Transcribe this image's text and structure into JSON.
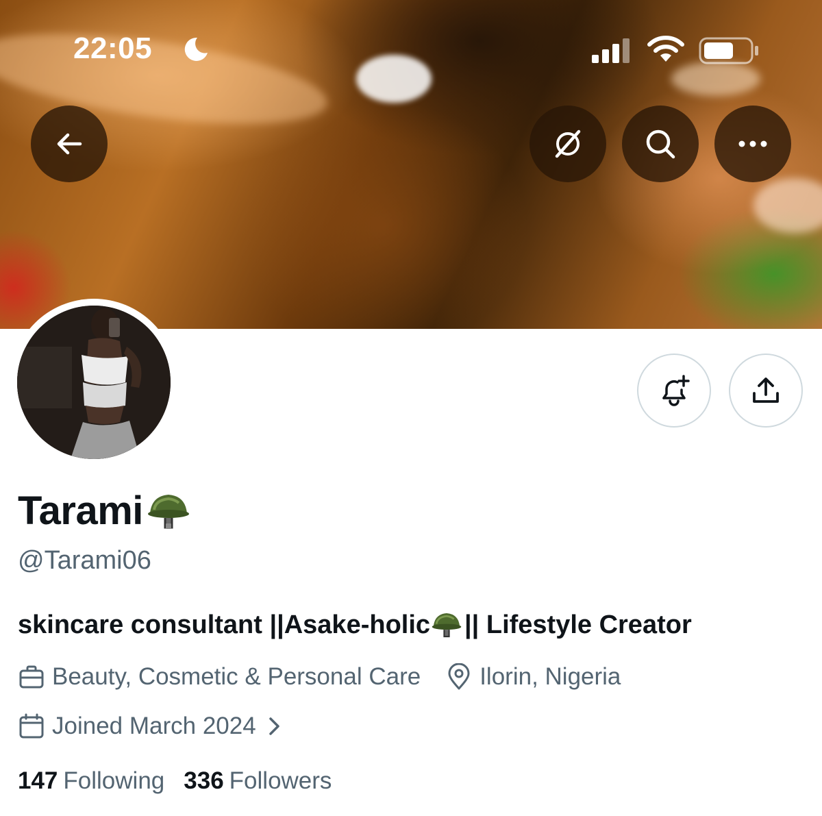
{
  "status_bar": {
    "time": "22:05"
  },
  "header": {
    "icons": [
      "back-arrow-icon",
      "grok-icon",
      "search-icon",
      "more-icon"
    ]
  },
  "profile": {
    "display_name": "Tarami",
    "name_emoji": "military-helmet-icon",
    "handle": "@Tarami06",
    "bio_part1": "skincare consultant ||Asake-holic",
    "bio_part2": "|| Lifestyle Creator",
    "category": "Beauty, Cosmetic & Personal Care",
    "location": "Ilorin, Nigeria",
    "joined": "Joined March 2024",
    "following_count": "147",
    "following_label": "Following",
    "followers_count": "336",
    "followers_label": "Followers"
  },
  "colors": {
    "text_primary": "#0f1419",
    "text_secondary": "#536471",
    "border": "#cfd9de",
    "header_button_bg": "#28160680"
  }
}
